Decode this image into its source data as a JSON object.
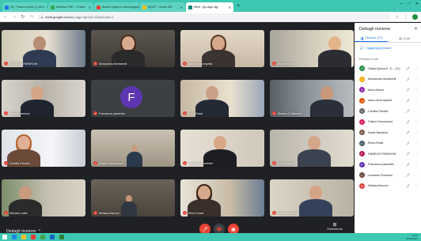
{
  "browser": {
    "tabs": [
      {
        "label": "PA - Posta in arrivo (1.619) - igianni...",
        "fav": "#1a73e8"
      },
      {
        "label": "Webinar PNC - H drive",
        "fav": "#34a853"
      },
      {
        "label": "Bando regioni in accompagnam...",
        "fav": "#ea4335"
      },
      {
        "label": "ASVIP - Green IGE",
        "fav": "#fbbc04"
      },
      {
        "label": "Meet - fpy-aqpr-bgi",
        "fav": "#00897b",
        "active": true
      }
    ],
    "new_tab": "+",
    "window_controls": [
      "—",
      "□",
      "✕"
    ],
    "url_host": "meet.google.com",
    "url_path": "/fpy-aqpr-bgi?pli=1&authuser=1"
  },
  "tiles": [
    {
      "name": "FABRIZIO PAPARONI",
      "scene": "office-flags"
    },
    {
      "name": "Alessandra Montanelli",
      "scene": "woman-dark"
    },
    {
      "name": "Anna cirina espella",
      "scene": "woman-office"
    },
    {
      "name": "Michele Lodi",
      "scene": "man-bald"
    },
    {
      "name": "raffaele raniucci",
      "scene": "man-window"
    },
    {
      "name": "Francesca piacentini",
      "scene": "avatar",
      "initial": "F"
    },
    {
      "name": "Erica Rossi",
      "scene": "man-flags"
    },
    {
      "name": "Stefano Di Benedo",
      "scene": "man-suit"
    },
    {
      "name": "Camilla Ghedini",
      "scene": "woman-logo"
    },
    {
      "name": "Chiara Francesconi",
      "scene": "room-wide"
    },
    {
      "name": "Leonardo Fiorentini",
      "scene": "man-beard"
    },
    {
      "name": "Dario Randis",
      "scene": "man-headset"
    },
    {
      "name": "Michele Lodini",
      "scene": "man-plant"
    },
    {
      "name": "Melissa Barconi",
      "scene": "room-dark"
    },
    {
      "name": "Elena Rossi",
      "scene": "woman-flags"
    },
    {
      "name": "Dante Bandiera",
      "scene": "man-glasses"
    }
  ],
  "bottom": {
    "meeting_details": "Dettagli riunione",
    "present_label": "Presenta ora"
  },
  "panel": {
    "title": "Dettagli riunione",
    "tab_people": "Persone (17)",
    "tab_chat": "Chat",
    "add_people": "Aggiungi persone",
    "in_call": "Persone in call",
    "participants": [
      {
        "initial": "G",
        "name": "Giada Quezzoli - E... (Tu)",
        "color": "#1e8e3e"
      },
      {
        "initial": "A",
        "name": "Alessandra Montanelli",
        "color": "#f9ab00"
      },
      {
        "initial": "A",
        "name": "Anna Assolo",
        "color": "#8e24aa"
      },
      {
        "initial": "a",
        "name": "anna cirina espella",
        "color": "#e65100"
      },
      {
        "initial": "C",
        "name": "Camilla Ghedini",
        "color": "#5f6368"
      },
      {
        "initial": "C",
        "name": "Chiara Francesconi",
        "color": "#d81b60"
      },
      {
        "initial": "D",
        "name": "Dante Bandiera",
        "color": "#795548"
      },
      {
        "initial": "E",
        "name": "Elena Rossi",
        "color": "#455a64"
      },
      {
        "initial": "F",
        "name": "FABRIZIO PAPARONI",
        "color": "#c2185b"
      },
      {
        "initial": "F",
        "name": "Francesca piacentini",
        "color": "#5e35b1"
      },
      {
        "initial": "L",
        "name": "Leonardo Fiorentini",
        "color": "#6d4c41"
      },
      {
        "initial": "M",
        "name": "Melissa Barconi",
        "color": "#e53935"
      }
    ]
  },
  "taskbar": {
    "time": "11:45",
    "date": "26/02/2021"
  },
  "colors": {
    "accent": "#1a73e8",
    "mute_red": "#ea4335",
    "chrome_teal": "#3ec7b3"
  }
}
